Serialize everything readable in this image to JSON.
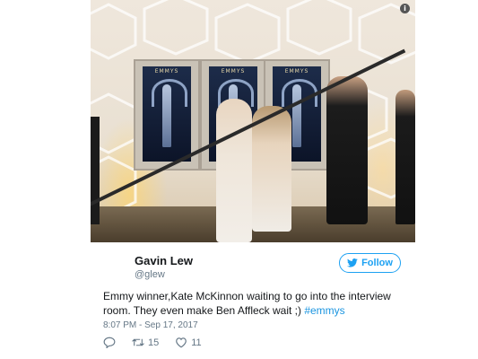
{
  "tweet": {
    "author_name": "Gavin Lew",
    "author_handle": "@glew",
    "follow_label": "Follow",
    "text_main": "Emmy winner,Kate McKinnon waiting to go into the interview room. They even make Ben Affleck wait ;) ",
    "hashtag": "#emmys",
    "timestamp": "8:07 PM - Sep 17, 2017",
    "retweet_count": "15",
    "like_count": "11"
  },
  "photo": {
    "poster_label": "EMMYS"
  },
  "colors": {
    "accent": "#1da1f2",
    "text": "#14171a",
    "secondary": "#657786"
  },
  "icons": [
    "info-icon",
    "twitter-bird-icon",
    "reply-icon",
    "retweet-icon",
    "like-icon"
  ]
}
